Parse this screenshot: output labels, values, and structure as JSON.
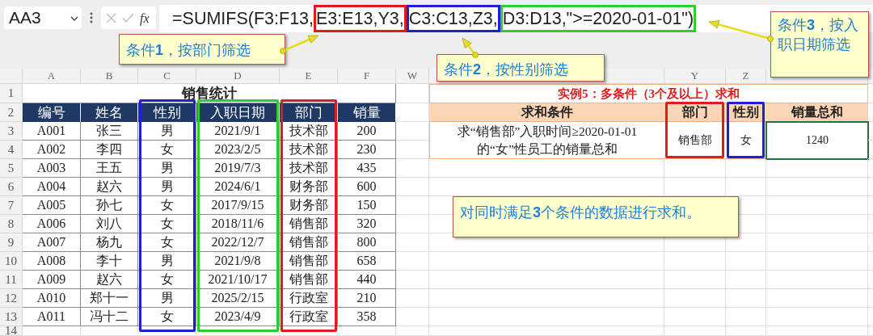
{
  "name_box": {
    "value": "AA3"
  },
  "formula_bar": {
    "fx": "fx",
    "segments": [
      {
        "text": "=SUMIFS(F3:F13,"
      },
      {
        "text": "E3:E13,Y3,",
        "color": "#e01b1b"
      },
      {
        "text": "C3:C13,Z3,",
        "color": "#1f1fd6"
      },
      {
        "text": "D3:D13,\">=2020-01-01\")",
        "color": "#2ecc2e"
      }
    ]
  },
  "column_headers": [
    "A",
    "B",
    "C",
    "D",
    "E",
    "F",
    "W",
    "Y",
    "Z"
  ],
  "row_numbers": [
    "1",
    "2",
    "3",
    "4",
    "5",
    "6",
    "7",
    "8",
    "9",
    "10",
    "11",
    "12",
    "13",
    "14"
  ],
  "sales_table": {
    "title": "销售统计",
    "columns": [
      {
        "label": "编号"
      },
      {
        "label": "姓名"
      },
      {
        "label": "性别",
        "color": "#1f1fd6"
      },
      {
        "label": "入职日期",
        "color": "#2ecc2e"
      },
      {
        "label": "部门",
        "color": "#e01b1b"
      },
      {
        "label": "销量"
      }
    ],
    "rows": [
      [
        "A001",
        "张三",
        "男",
        "2021/9/1",
        "技术部",
        "200"
      ],
      [
        "A002",
        "李四",
        "女",
        "2023/2/5",
        "技术部",
        "230"
      ],
      [
        "A003",
        "王五",
        "男",
        "2019/7/3",
        "技术部",
        "435"
      ],
      [
        "A004",
        "赵六",
        "男",
        "2024/6/1",
        "财务部",
        "600"
      ],
      [
        "A005",
        "孙七",
        "女",
        "2017/9/15",
        "财务部",
        "150"
      ],
      [
        "A006",
        "刘八",
        "女",
        "2018/11/6",
        "销售部",
        "320"
      ],
      [
        "A007",
        "杨九",
        "女",
        "2022/12/7",
        "销售部",
        "800"
      ],
      [
        "A008",
        "李十",
        "男",
        "2021/9/8",
        "销售部",
        "658"
      ],
      [
        "A009",
        "赵六",
        "女",
        "2021/10/17",
        "销售部",
        "440"
      ],
      [
        "A010",
        "郑十一",
        "男",
        "2025/2/15",
        "行政室",
        "210"
      ],
      [
        "A011",
        "冯十二",
        "女",
        "2023/4/9",
        "行政室",
        "358"
      ]
    ]
  },
  "example": {
    "title": "实例5：多条件（3个及以上）求和",
    "columns": [
      {
        "label": "求和条件"
      },
      {
        "label": "部门",
        "color": "#e01b1b"
      },
      {
        "label": "性别",
        "color": "#1f1fd6"
      },
      {
        "label": "销量总和"
      }
    ],
    "cells": [
      {
        "text": "求“销售部”入职时间≥2020-01-01的“女”性员工的销量总和",
        "selected": false
      },
      {
        "text": "销售部",
        "selected": false
      },
      {
        "text": "女",
        "selected": false
      },
      {
        "text": "1240",
        "selected": true
      }
    ]
  },
  "callouts": [
    {
      "text": "条件**1**，按部门筛选"
    },
    {
      "text": "条件**2**，按性别筛选"
    },
    {
      "text": "条件**3**，按入职日期筛选"
    },
    {
      "text": "对同时满足**3**个条件的数据进行求和。"
    }
  ]
}
